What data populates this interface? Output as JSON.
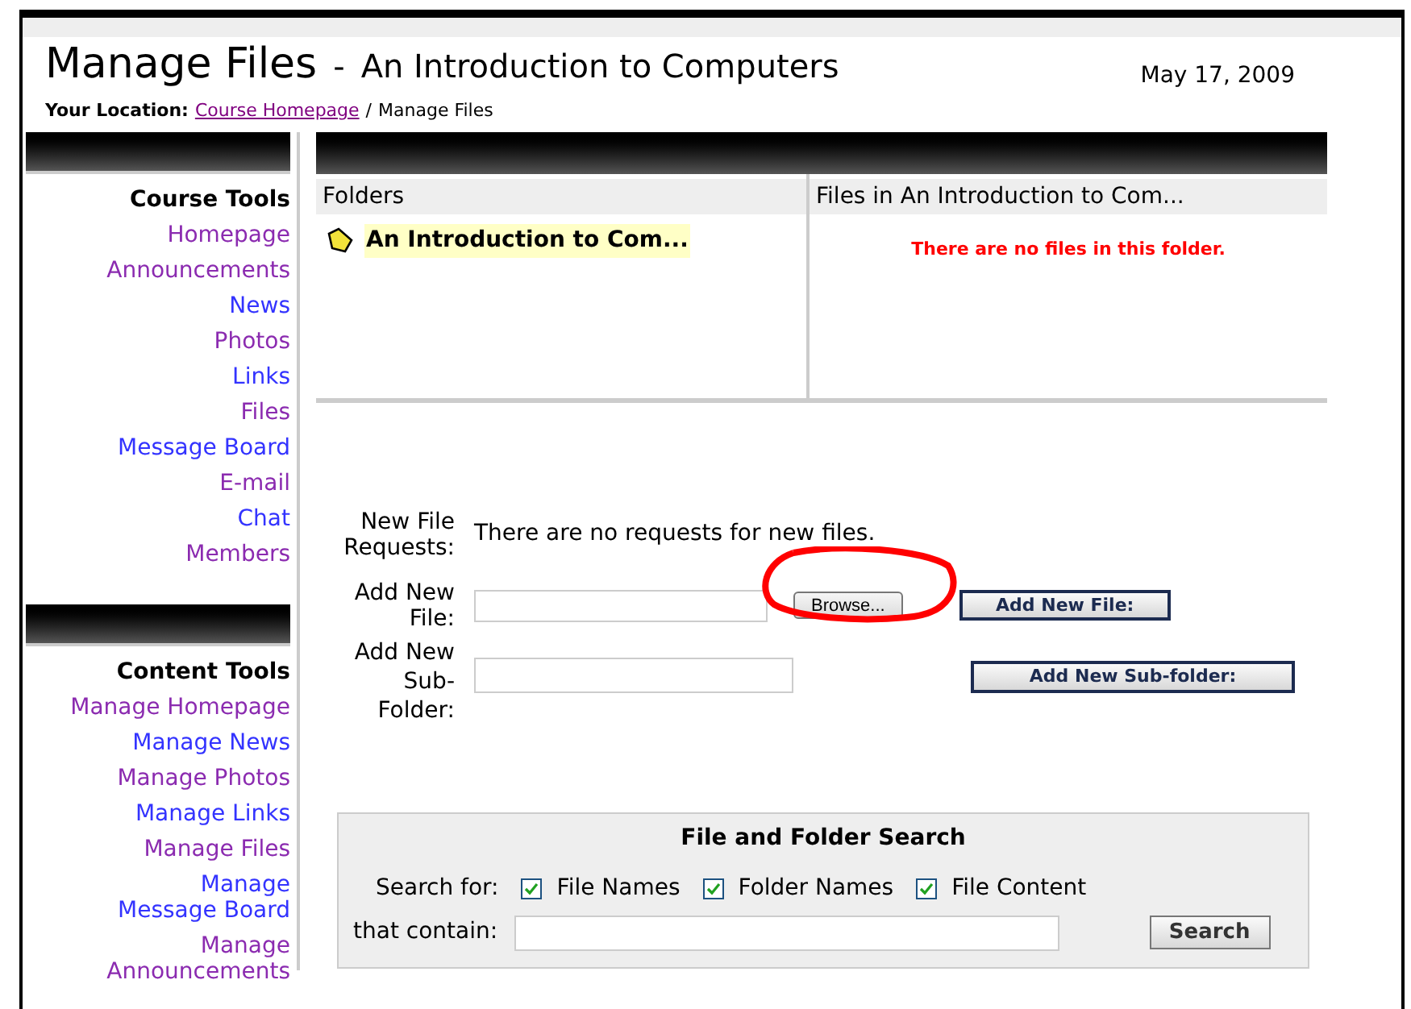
{
  "header": {
    "title": "Manage Files",
    "subtitle": "An Introduction to Computers",
    "separator": "-",
    "date": "May 17, 2009"
  },
  "breadcrumb": {
    "label": "Your Location:",
    "link": "Course Homepage",
    "separator": "/",
    "current": "Manage Files"
  },
  "sidebar": [
    {
      "heading": "Course Tools",
      "items": [
        {
          "label": "Homepage",
          "visited": true
        },
        {
          "label": "Announcements",
          "visited": true
        },
        {
          "label": "News",
          "visited": false
        },
        {
          "label": "Photos",
          "visited": true
        },
        {
          "label": "Links",
          "visited": false
        },
        {
          "label": "Files",
          "visited": true
        },
        {
          "label": "Message Board",
          "visited": false
        },
        {
          "label": "E-mail",
          "visited": true
        },
        {
          "label": "Chat",
          "visited": false
        },
        {
          "label": "Members",
          "visited": true
        }
      ]
    },
    {
      "heading": "Content Tools",
      "items": [
        {
          "label": "Manage Homepage",
          "visited": true
        },
        {
          "label": "Manage News",
          "visited": false
        },
        {
          "label": "Manage Photos",
          "visited": true
        },
        {
          "label": "Manage Links",
          "visited": false
        },
        {
          "label": "Manage Files",
          "visited": true
        },
        {
          "label": "Manage Message Board",
          "visited": false
        },
        {
          "label": "Manage Announcements",
          "visited": true
        }
      ]
    }
  ],
  "folders": {
    "heading": "Folders",
    "items": [
      {
        "label": "An Introduction to Com...",
        "selected": true
      }
    ]
  },
  "files": {
    "heading": "Files in An Introduction to Com...",
    "empty_message": "There are no files in this folder."
  },
  "form": {
    "requests_label": "New File Requests:",
    "requests_text": "There are no requests for new files.",
    "file_label": "Add New File:",
    "browse_button": "Browse...",
    "add_file_button": "Add New File:",
    "subfolder_label": "Add New Sub-Folder:",
    "add_subfolder_button": "Add New Sub-folder:"
  },
  "annotation": {
    "kind": "circle",
    "color": "#ff0000"
  },
  "search": {
    "title": "File and Folder Search",
    "search_for_label": "Search for:",
    "options": [
      {
        "label": "File Names",
        "checked": true
      },
      {
        "label": "Folder Names",
        "checked": true
      },
      {
        "label": "File Content",
        "checked": true
      }
    ],
    "contain_label": "that contain:",
    "button": "Search"
  }
}
